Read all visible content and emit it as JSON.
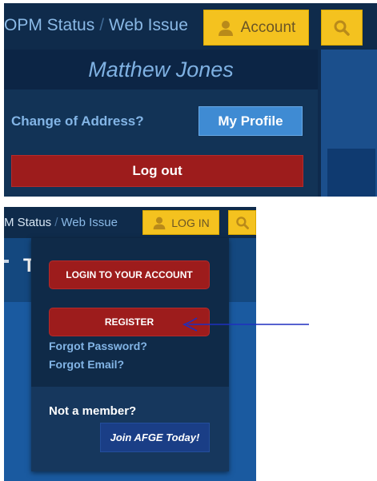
{
  "logged_in_panel": {
    "breadcrumb": {
      "item1": "OPM Status",
      "separator": "/",
      "item2": "Web Issue"
    },
    "account_button": {
      "label": "Account",
      "icon": "user-icon"
    },
    "search_button": {
      "icon": "search-icon"
    },
    "user_name": "Matthew Jones",
    "change_of_address_link": "Change of Address?",
    "my_profile_button": "My Profile",
    "logout_button": "Log out"
  },
  "logged_out_panel": {
    "breadcrumb": {
      "item1": "M Status",
      "separator": "/",
      "item2": "Web Issue"
    },
    "login_button": {
      "label": "LOG IN",
      "icon": "user-icon"
    },
    "search_button": {
      "icon": "search-icon"
    },
    "background_heading_letter": "T",
    "dropdown": {
      "login_account_button": "LOGIN TO YOUR ACCOUNT",
      "register_button": "REGISTER",
      "forgot_password_link": "Forgot Password?",
      "forgot_email_link": "Forgot Email?",
      "not_member_text": "Not a member?",
      "join_button": "Join AFGE Today!"
    }
  },
  "annotation": {
    "arrow_color": "#1f2fbf",
    "arrow_points_to": "register-button"
  },
  "colors": {
    "navy": "#0f2b4b",
    "gold": "#f4c21f",
    "red_button": "#9d1c1c",
    "blue_button": "#3f8bd3",
    "link_blue": "#83b5e6"
  }
}
